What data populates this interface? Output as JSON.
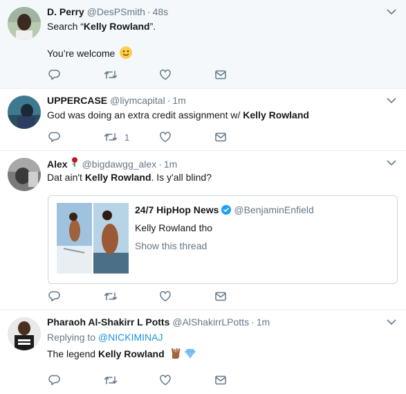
{
  "tweets": [
    {
      "name": "D. Perry",
      "handle": "@DesPSmith",
      "time": "48s",
      "line1_pre": "Search “",
      "line1_bold": "Kelly Rowland",
      "line1_post": "”.",
      "line2": "You’re welcome",
      "line2_emoji": "slightly-smiling-face",
      "retweet_count": ""
    },
    {
      "name": "UPPERCASE",
      "handle": "@liymcapital",
      "time": "1m",
      "text_pre": "God was doing an extra credit assignment w/ ",
      "text_bold": "Kelly Rowland",
      "retweet_count": "1"
    },
    {
      "name": "Alex",
      "name_emoji": "rose",
      "handle": "@bigdawgg_alex",
      "time": "1m",
      "text_pre": "Dat ain't ",
      "text_bold": "Kelly Rowland",
      "text_post": ". Is y'all blind?",
      "quote": {
        "name": "24/7 HipHop News",
        "verified": true,
        "handle": "@BenjaminEnfield",
        "text": "Kelly Rowland tho",
        "thread_link": "Show this thread"
      }
    },
    {
      "name": "Pharaoh Al-Shakirr L Potts",
      "handle": "@AlShakirrLPotts",
      "time": "1m",
      "replying_label": "Replying to ",
      "replying_handle": "@NICKIMINAJ",
      "text_pre": "The legend ",
      "text_bold": "Kelly Rowland",
      "text_emojis": [
        "horns-sign-medium-dark",
        "gem-stone"
      ]
    }
  ],
  "separator": "·",
  "icons": [
    "reply-icon",
    "retweet-icon",
    "like-icon",
    "direct-message-icon",
    "caret-down-icon"
  ],
  "colors": {
    "icon_gray": "#657786",
    "link_blue": "#1b95e0",
    "border": "#e6ecf0",
    "highlight_bg": "#f5f8fa"
  }
}
